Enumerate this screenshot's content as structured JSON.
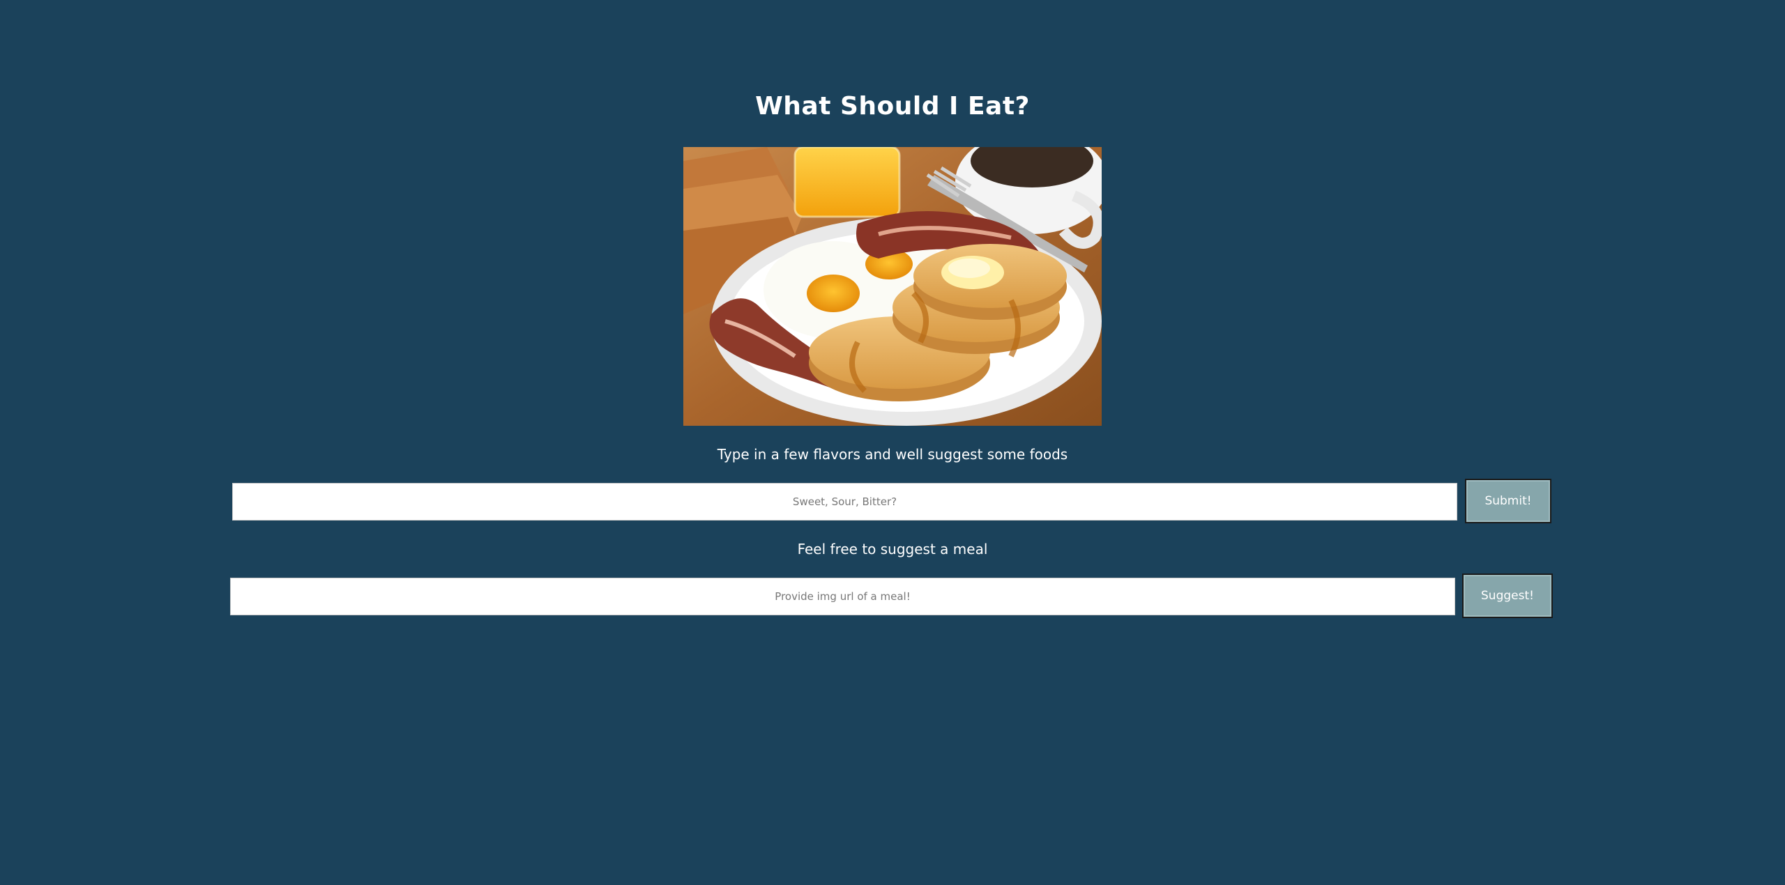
{
  "header": {
    "title": "What Should I Eat?"
  },
  "hero_image": {
    "icon": "breakfast-photo"
  },
  "flavor_section": {
    "prompt": "Type in a few flavors and well suggest some foods",
    "input_placeholder": "Sweet, Sour, Bitter?",
    "input_value": "",
    "button_label": "Submit!"
  },
  "meal_section": {
    "prompt": "Feel free to suggest a meal",
    "input_placeholder": "Provide img url of a meal!",
    "input_value": "",
    "button_label": "Suggest!"
  },
  "colors": {
    "background": "#1b425b",
    "button": "#86a6ab",
    "text": "#ffffff"
  }
}
